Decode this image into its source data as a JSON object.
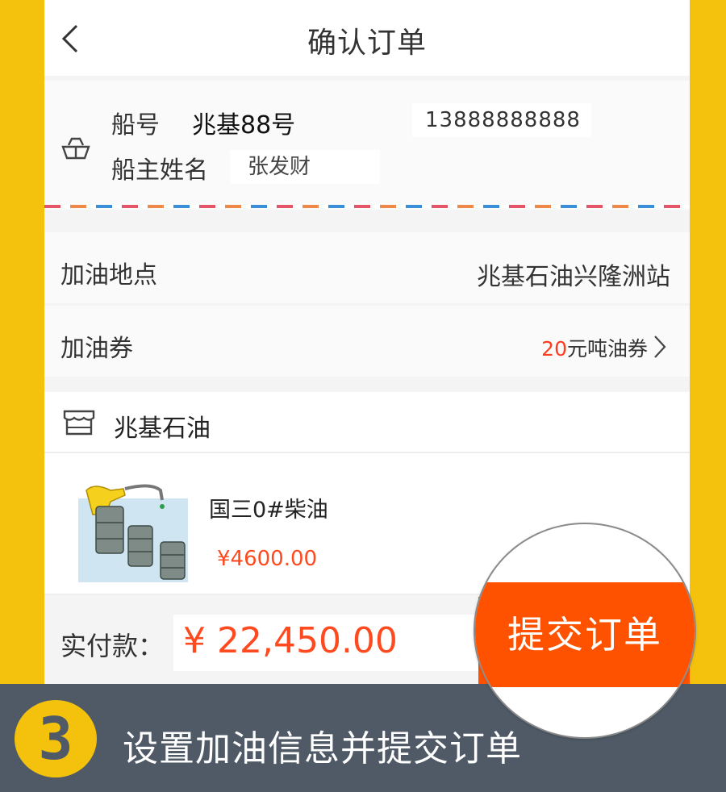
{
  "header": {
    "title": "确认订单"
  },
  "ship": {
    "number_label": "船号",
    "number_value": "兆基88号",
    "phone": "13888888888",
    "owner_label": "船主姓名",
    "owner_value": "张发财"
  },
  "location": {
    "label": "加油地点",
    "value": "兆基石油兴隆洲站"
  },
  "coupon": {
    "label": "加油券",
    "amount": "20",
    "unit_text": "元吨油券"
  },
  "shop": {
    "name": "兆基石油"
  },
  "product": {
    "name": "国三0#柴油",
    "price": "¥4600.00"
  },
  "footer": {
    "pay_label": "实付款：",
    "pay_amount": "¥ 22,450.00",
    "submit_label": "提交订单"
  },
  "instruction": {
    "step": "3",
    "text": "设置加油信息并提交订单"
  },
  "colors": {
    "accent": "#ff5200",
    "price": "#ff4a1f",
    "frame": "#f4c20d",
    "instruction_bar": "#4f5a66"
  },
  "icons": [
    "back-icon",
    "ship-icon",
    "chevron-right-icon",
    "shop-icon",
    "fuel-product-image"
  ]
}
